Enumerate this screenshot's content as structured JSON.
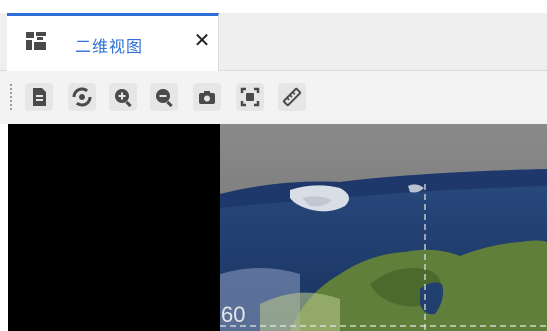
{
  "tab": {
    "icon": "map-grid-icon",
    "label": "二维视图",
    "close_glyph": "✕"
  },
  "toolbar": {
    "buttons": [
      {
        "name": "document-button",
        "icon": "document-icon"
      },
      {
        "name": "reset-view-button",
        "icon": "reset-view-icon"
      },
      {
        "name": "zoom-in-button",
        "icon": "zoom-in-icon"
      },
      {
        "name": "zoom-out-button",
        "icon": "zoom-out-icon"
      },
      {
        "name": "screenshot-button",
        "icon": "camera-icon"
      },
      {
        "name": "fit-view-button",
        "icon": "fit-extent-icon"
      },
      {
        "name": "measure-button",
        "icon": "ruler-icon"
      }
    ]
  },
  "map": {
    "grid_label": "60"
  },
  "colors": {
    "accent": "#2f6fd6",
    "icon": "#4a4a4a",
    "ocean": "#1f3d73",
    "land": "#5f7f3a",
    "ice": "#d8dde6"
  }
}
